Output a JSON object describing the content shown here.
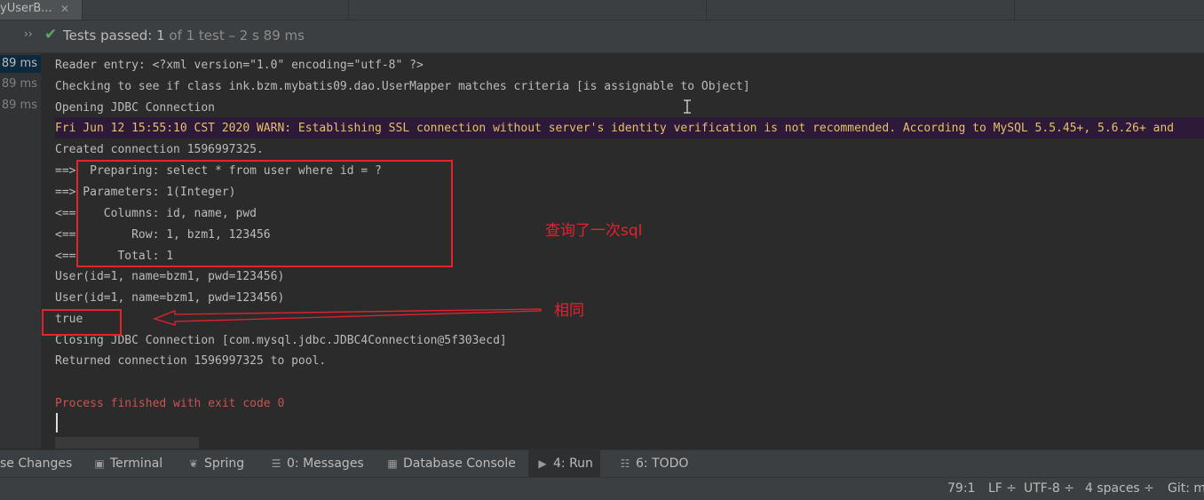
{
  "colors": {
    "background": "#2b2b2b",
    "panel": "#3c3f41",
    "success": "#59a869",
    "warning_text": "#e8bf6a",
    "error_text": "#c75450",
    "annotation_red": "#e8212e"
  },
  "editor_tab": {
    "label": "yUserB...",
    "close_icon": "close-icon",
    "close_glyph": "✕"
  },
  "run_header": {
    "expand_glyph": "››",
    "check_glyph": "✔",
    "status_bold": "Tests passed:",
    "count": "1",
    "suffix": "of 1 test – 2 s 89 ms"
  },
  "gutter": {
    "rows": [
      "89 ms",
      "89 ms",
      "89 ms"
    ]
  },
  "console": {
    "lines": [
      "Reader entry: <?xml version=\"1.0\" encoding=\"utf-8\" ?>",
      "Checking to see if class ink.bzm.mybatis09.dao.UserMapper matches criteria [is assignable to Object]",
      "Opening JDBC Connection",
      "Fri Jun 12 15:55:10 CST 2020 WARN: Establishing SSL connection without server's identity verification is not recommended. According to MySQL 5.5.45+, 5.6.26+ and",
      "Created connection 1596997325.",
      "==>  Preparing: select * from user where id = ?",
      "==> Parameters: 1(Integer)",
      "<==    Columns: id, name, pwd",
      "<==        Row: 1, bzm1, 123456",
      "<==      Total: 1",
      "User(id=1, name=bzm1, pwd=123456)",
      "User(id=1, name=bzm1, pwd=123456)",
      "true",
      "Closing JDBC Connection [com.mysql.jdbc.JDBC4Connection@5f303ecd]",
      "Returned connection 1596997325 to pool.",
      "",
      "Process finished with exit code 0"
    ]
  },
  "annotations": {
    "sql_once": "查询了一次sql",
    "same": "相同"
  },
  "tool_windows": [
    {
      "icon": "changes-icon",
      "glyph": "",
      "label": "se Changes"
    },
    {
      "icon": "terminal-icon",
      "glyph": "▣",
      "label": "Terminal"
    },
    {
      "icon": "spring-icon",
      "glyph": "❦",
      "label": "Spring"
    },
    {
      "icon": "messages-icon",
      "glyph": "☰",
      "label": "0: Messages"
    },
    {
      "icon": "database-console-icon",
      "glyph": "▦",
      "label": "Database Console"
    },
    {
      "icon": "run-icon",
      "glyph": "▶",
      "label": "4: Run",
      "active": true
    },
    {
      "icon": "todo-icon",
      "glyph": "☷",
      "label": "6: TODO"
    }
  ],
  "status_bar": {
    "position": "79:1",
    "line_ending": "LF ÷",
    "encoding": "UTF-8 ÷",
    "indent": "4 spaces ÷",
    "vcs": "Git: m"
  }
}
